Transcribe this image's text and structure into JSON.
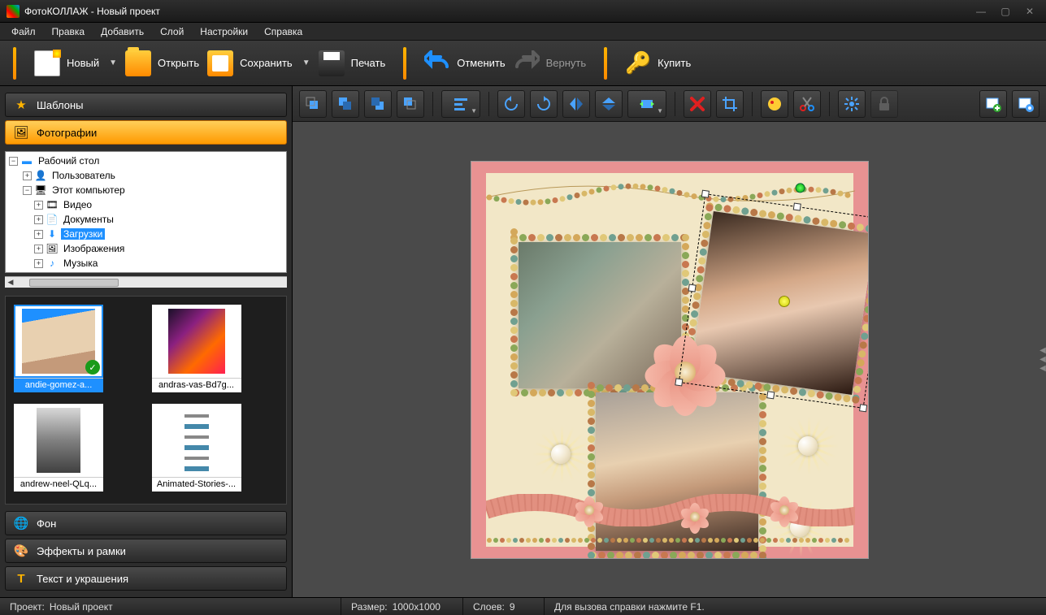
{
  "window": {
    "title": "ФотоКОЛЛАЖ - Новый проект"
  },
  "menu": {
    "file": "Файл",
    "edit": "Правка",
    "add": "Добавить",
    "layer": "Слой",
    "settings": "Настройки",
    "help": "Справка"
  },
  "toolbar": {
    "new": "Новый",
    "open": "Открыть",
    "save": "Сохранить",
    "print": "Печать",
    "undo": "Отменить",
    "redo": "Вернуть",
    "buy": "Купить"
  },
  "sidebar": {
    "templates": "Шаблоны",
    "photos": "Фотографии",
    "background": "Фон",
    "effects": "Эффекты и рамки",
    "text": "Текст и украшения"
  },
  "tree": {
    "desktop": "Рабочий стол",
    "user": "Пользователь",
    "computer": "Этот компьютер",
    "video": "Видео",
    "documents": "Документы",
    "downloads": "Загрузки",
    "pictures": "Изображения",
    "music": "Музыка"
  },
  "thumbs": {
    "t1": "andie-gomez-a...",
    "t2": "andras-vas-Bd7g...",
    "t3": "andrew-neel-QLq...",
    "t4": "Animated-Stories-..."
  },
  "status": {
    "project_lbl": "Проект:",
    "project_val": "Новый проект",
    "size_lbl": "Размер:",
    "size_val": "1000x1000",
    "layers_lbl": "Слоев:",
    "layers_val": "9",
    "help": "Для вызова справки нажмите F1."
  },
  "colors": {
    "accent_orange": "#ff9a00",
    "canvas_bg": "#4a4a4a",
    "page_border": "#e89292",
    "page_paper": "#f2e7c7",
    "selection_blue": "#1e90ff"
  }
}
